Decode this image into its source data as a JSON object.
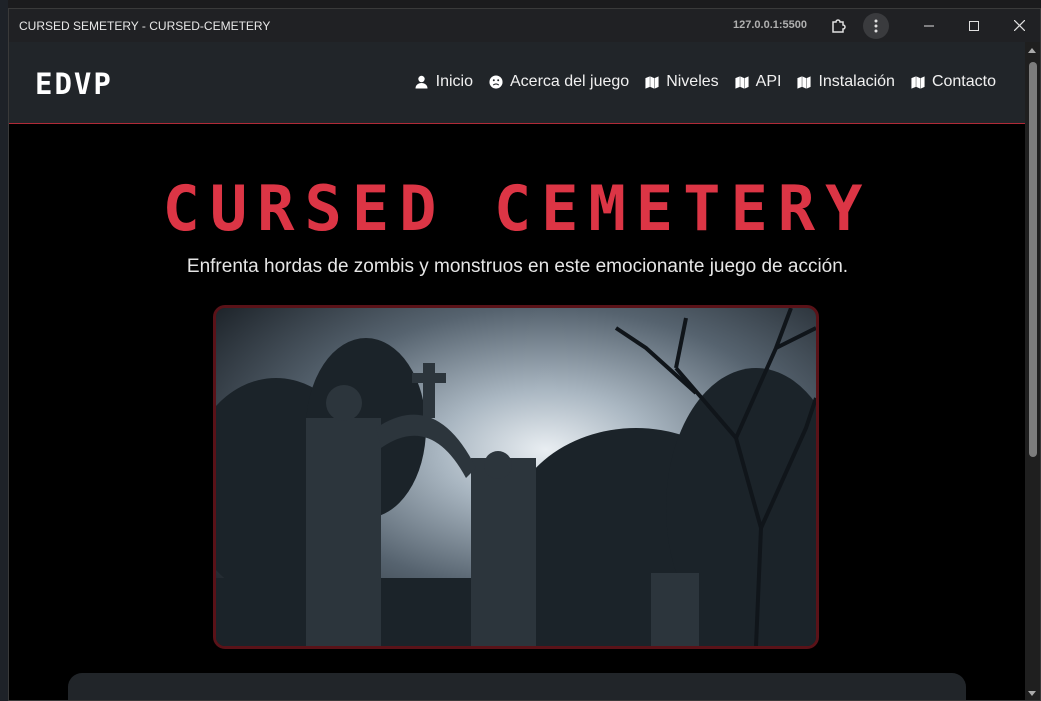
{
  "window": {
    "title": "CURSED SEMETERY - CURSED-CEMETERY",
    "url": "127.0.0.1:5500",
    "icons": [
      "extension-icon",
      "menu-dots-icon",
      "minimize-icon",
      "maximize-icon",
      "close-icon"
    ]
  },
  "navbar": {
    "brand": "EDVP",
    "items": [
      {
        "label": "Inicio",
        "icon": "user-icon"
      },
      {
        "label": "Acerca del juego",
        "icon": "sad-face-icon"
      },
      {
        "label": "Niveles",
        "icon": "map-icon"
      },
      {
        "label": "API",
        "icon": "map-icon"
      },
      {
        "label": "Instalación",
        "icon": "map-icon"
      },
      {
        "label": "Contacto",
        "icon": "map-icon"
      }
    ]
  },
  "hero": {
    "title": "CURSED CEMETERY",
    "subtitle": "Enfrenta hordas de zombis y monstruos en este emocionante juego de acción."
  },
  "colors": {
    "accent": "#dc3545",
    "navbar_bg": "#212529",
    "page_bg": "#000000"
  }
}
